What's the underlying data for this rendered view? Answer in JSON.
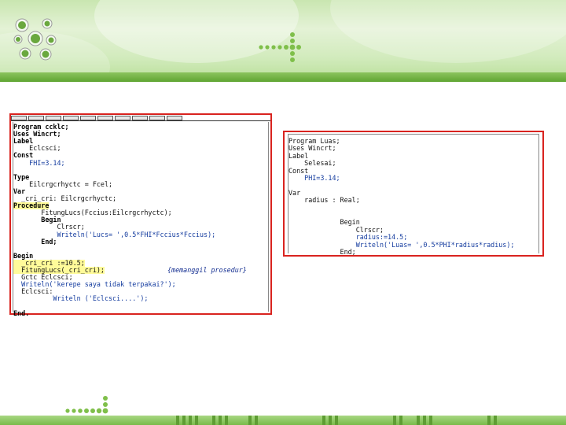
{
  "slide": {
    "banner_color": "#c9e6b0",
    "stripe_color": "#6aae3e",
    "accent_color": "#8bc34a",
    "logo_icon": "green-flower-logo-icon",
    "arrow_icon": "dotted-arrow-icon"
  },
  "left_panel": {
    "toolbar_icons": [
      "file-icon",
      "edit-icon",
      "search-icon",
      "run-icon",
      "compile-icon",
      "debug-icon",
      "tools-icon",
      "options-icon",
      "window-icon",
      "help-icon"
    ],
    "lines": [
      {
        "text": "Program ccklc;",
        "style": "kw"
      },
      {
        "text": "Uses Wincrt;",
        "style": "kw"
      },
      {
        "text": "Label",
        "style": "kw"
      },
      {
        "text": "    Eclcsci;",
        "style": ""
      },
      {
        "text": "Const",
        "style": "kw"
      },
      {
        "text": "    FHI=3.14;",
        "style": "str"
      },
      {
        "text": "",
        "style": ""
      },
      {
        "text": "Type",
        "style": "kw"
      },
      {
        "text": "    Eilcrgcrhyctc = Fcel;",
        "style": ""
      },
      {
        "text": "Var",
        "style": "kw"
      },
      {
        "text": "  _cri_cri: Eilcrgcrhyctc;",
        "style": ""
      },
      {
        "text": "Procedure",
        "style": "kw hl"
      },
      {
        "text": "       FitungLucs(Fccius:Eilcrgcrhyctc);",
        "style": ""
      },
      {
        "text": "       Begin",
        "style": "kw"
      },
      {
        "text": "           Clrscr;",
        "style": ""
      },
      {
        "text": "           Writeln('Lucs= ',0.5*FHI*Fccius*Fccius);",
        "style": "str"
      },
      {
        "text": "       End;",
        "style": "kw"
      },
      {
        "text": "",
        "style": ""
      },
      {
        "text": "Begin",
        "style": "kw"
      },
      {
        "text": "  _cri_cri :=10.5;",
        "style": "hl"
      },
      {
        "text": "  FitungLucs(_cri_cri);",
        "style": "hl"
      },
      {
        "text": "  Gctc Eclcsci;",
        "style": ""
      },
      {
        "text": "  Writeln('kerepe saya tidak terpakai?');",
        "style": "str"
      },
      {
        "text": "  Eclcsci:",
        "style": ""
      },
      {
        "text": "          Writeln ('Eclcsci....');",
        "style": "str"
      },
      {
        "text": "",
        "style": ""
      },
      {
        "text": "End.",
        "style": "kw"
      }
    ],
    "comment": "{memanggil prosedur}"
  },
  "right_panel": {
    "lines": [
      {
        "text": "Program Luas;",
        "style": ""
      },
      {
        "text": "Uses Wincrt;",
        "style": ""
      },
      {
        "text": "Label",
        "style": ""
      },
      {
        "text": "    Selesai;",
        "style": ""
      },
      {
        "text": "Const",
        "style": ""
      },
      {
        "text": "    PHI=3.14;",
        "style": "str"
      },
      {
        "text": "",
        "style": ""
      },
      {
        "text": "Var",
        "style": ""
      },
      {
        "text": "    radius : Real;",
        "style": ""
      },
      {
        "text": "",
        "style": ""
      },
      {
        "text": "",
        "style": ""
      },
      {
        "text": "             Begin",
        "style": ""
      },
      {
        "text": "                 Clrscr;",
        "style": ""
      },
      {
        "text": "                 radius:=14.5;",
        "style": "str"
      },
      {
        "text": "                 Writeln('Luas= ',0.5*PHI*radius*radius);",
        "style": "str"
      },
      {
        "text": "             End;",
        "style": ""
      }
    ]
  }
}
